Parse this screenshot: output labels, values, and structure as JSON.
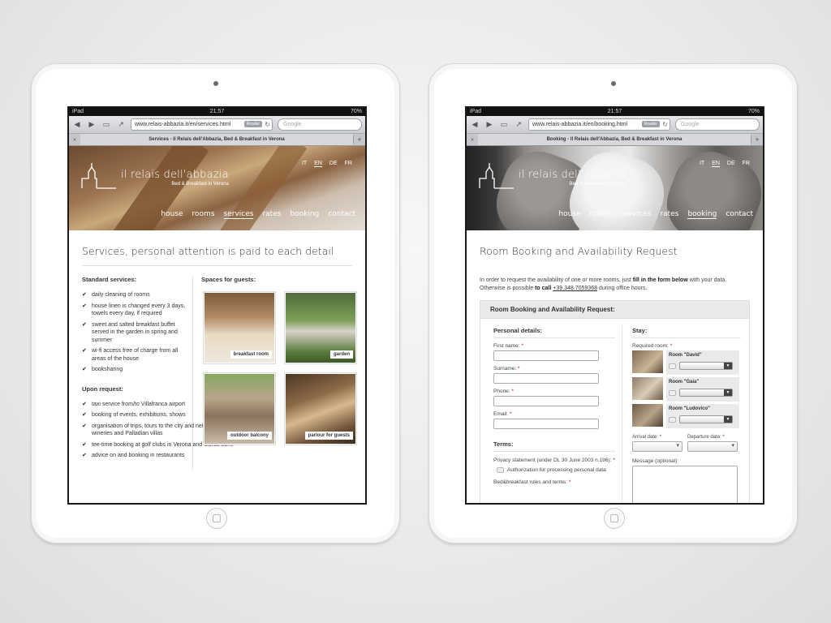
{
  "device": {
    "model_label": "iPad",
    "time": "21:57",
    "battery": "70%"
  },
  "left": {
    "url": "www.relais-abbazia.it/en/services.html",
    "reader": "Reader",
    "search_placeholder": "Google",
    "tab_title": "Services - Il Relais dell'Abbazia, Bed & Breakfast in Verona",
    "site": {
      "logo_name": "il relais dell'abbazia",
      "logo_tagline": "Bed & Breakfast in Verona",
      "langs": [
        "IT",
        "EN",
        "DE",
        "FR"
      ],
      "menu": [
        "house",
        "rooms",
        "services",
        "rates",
        "booking",
        "contact"
      ]
    },
    "title": "Services, personal attention is paid to each detail",
    "standard": {
      "heading": "Standard services:",
      "items": [
        "daily cleaning of rooms",
        "house linen is changed every 3 days, towels every day, if required",
        "sweet and salted breakfast buffet served in the garden in spring and summer",
        "wi-fi access free of charge from all areas of the house",
        "booksharing"
      ]
    },
    "upon": {
      "heading": "Upon request:",
      "items": [
        "taxi service from/to Villafranca airport",
        "booking of events, exhibitions, shows",
        "organisation of trips, tours to the city and neighbouring areas, to wineries and Palladian villas",
        "tee-time booking at golf clubs in Verona and Garda Lake",
        "advice on and booking in restaurants"
      ]
    },
    "spaces": {
      "heading": "Spaces for guests:",
      "tiles": [
        "breakfast room",
        "garden",
        "outdoor balcony",
        "parlour for guests"
      ]
    }
  },
  "right": {
    "url": "www.relais-abbazia.it/en/booking.html",
    "reader": "Reader",
    "search_placeholder": "Google",
    "tab_title": "Booking - Il Relais dell'Abbazia, Bed & Breakfast in Verona",
    "title": "Room Booking and Availability Request",
    "intro_1": "In order to request the availability of one or more rooms, just ",
    "intro_bold": "fill in the form below",
    "intro_2": " with your data.",
    "intro_3": "Otherwise is possible ",
    "intro_call": "to call",
    "intro_phone": "+39.348.7059368",
    "intro_4": " during office hours.",
    "form_title": "Room Booking and Availability Request:",
    "personal": {
      "heading": "Personal details:",
      "fields": [
        "First name:",
        "Surname:",
        "Phone:",
        "Email:"
      ]
    },
    "terms": {
      "heading": "Terms:",
      "privacy": "Privacy statement (under DL 30 June 2003 n.196):",
      "auth": "Authorization for processing personal data",
      "rules": "Bed&breakfast rules and terms:"
    },
    "stay": {
      "heading": "Stay:",
      "required_room": "Required room:",
      "rooms": [
        "Room \"David\"",
        "Room \"Gaia\"",
        "Room \"Ludovico\""
      ],
      "arrival": "Arrival date:",
      "departure": "Departure date:",
      "message": "Message (optional):"
    }
  }
}
